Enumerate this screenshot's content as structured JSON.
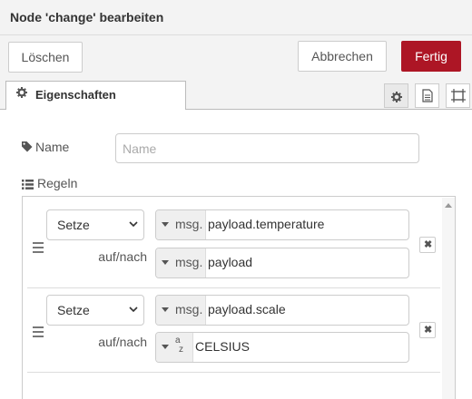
{
  "dialog": {
    "title": "Node 'change' bearbeiten"
  },
  "toolbar": {
    "delete_label": "Löschen",
    "cancel_label": "Abbrechen",
    "done_label": "Fertig"
  },
  "tabs": {
    "properties_label": "Eigenschaften"
  },
  "form": {
    "name_label": "Name",
    "name_value": "",
    "name_placeholder": "Name",
    "rules_label": "Regeln"
  },
  "rules": [
    {
      "action": "Setze",
      "target_prefix": "msg.",
      "target": "payload.temperature",
      "to_label": "auf/nach",
      "value_prefix": "msg.",
      "value": "payload",
      "value_type_icon": "msg-type"
    },
    {
      "action": "Setze",
      "target_prefix": "msg.",
      "target": "payload.scale",
      "to_label": "auf/nach",
      "value_prefix": "",
      "value": "CELSIUS",
      "value_type_icon": "string-type-az"
    }
  ],
  "colors": {
    "primary": "#ad1625",
    "header_bg": "#f3f3f3"
  }
}
